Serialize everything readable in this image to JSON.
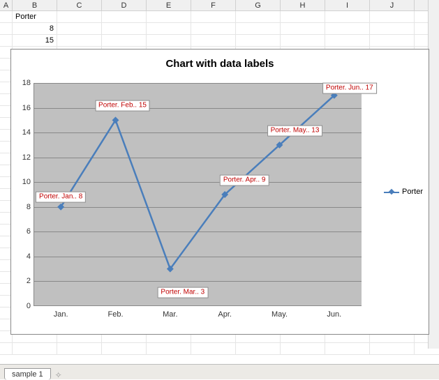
{
  "columns": [
    "A",
    "B",
    "C",
    "D",
    "E",
    "F",
    "G",
    "H",
    "I",
    "J"
  ],
  "cells": {
    "b1": "Porter",
    "b2": "8",
    "b3": "15"
  },
  "chart_data": {
    "type": "line",
    "title": "Chart with data labels",
    "categories": [
      "Jan.",
      "Feb.",
      "Mar.",
      "Apr.",
      "May.",
      "Jun."
    ],
    "series": [
      {
        "name": "Porter",
        "values": [
          8,
          15,
          3,
          9,
          13,
          17
        ]
      }
    ],
    "xlabel": "",
    "ylabel": "",
    "ylim": [
      0,
      18
    ],
    "ystep": 2,
    "data_labels": [
      "Porter. Jan.. 8",
      "Porter. Feb.. 15",
      "Porter. Mar.. 3",
      "Porter. Apr.. 9",
      "Porter. May.. 13",
      "Porter. Jun.. 17"
    ]
  },
  "legend": {
    "label": "Porter"
  },
  "tabs": {
    "active": "sample 1"
  }
}
